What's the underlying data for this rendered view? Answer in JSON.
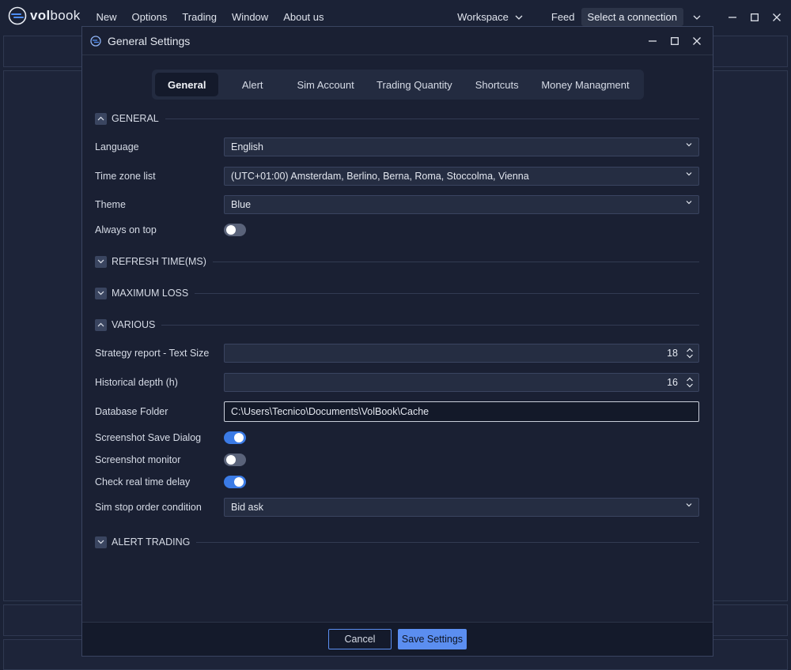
{
  "app": {
    "logo_text_bold": "vol",
    "logo_text_rest": "book",
    "menu": [
      "New",
      "Options",
      "Trading",
      "Window",
      "About us"
    ],
    "workspace_label": "Workspace",
    "feed_label": "Feed",
    "connection_label": "Select a connection"
  },
  "dialog": {
    "title": "General Settings",
    "tabs": [
      {
        "label": "General",
        "active": true
      },
      {
        "label": "Alert",
        "active": false
      },
      {
        "label": "Sim Account",
        "active": false
      },
      {
        "label": "Trading Quantity",
        "active": false
      },
      {
        "label": "Shortcuts",
        "active": false
      },
      {
        "label": "Money Managment",
        "active": false
      }
    ],
    "sections": {
      "general": "GENERAL",
      "refresh": "REFRESH TIME(MS)",
      "max_loss": "MAXIMUM LOSS",
      "various": "VARIOUS",
      "alert_trading": "ALERT TRADING"
    },
    "general": {
      "language_label": "Language",
      "language_value": "English",
      "timezone_label": "Time zone list",
      "timezone_value": "(UTC+01:00) Amsterdam, Berlino, Berna, Roma, Stoccolma, Vienna",
      "theme_label": "Theme",
      "theme_value": "Blue",
      "always_on_top_label": "Always on top",
      "always_on_top": false
    },
    "various": {
      "strategy_text_size_label": "Strategy report - Text Size",
      "strategy_text_size_value": "18",
      "historical_depth_label": "Historical depth (h)",
      "historical_depth_value": "16",
      "database_folder_label": "Database Folder",
      "database_folder_value": "C:\\Users\\Tecnico\\Documents\\VolBook\\Cache",
      "screenshot_save_dialog_label": "Screenshot Save Dialog",
      "screenshot_save_dialog": true,
      "screenshot_monitor_label": "Screenshot monitor",
      "screenshot_monitor": false,
      "check_real_time_delay_label": "Check real time delay",
      "check_real_time_delay": true,
      "sim_stop_label": "Sim stop order condition",
      "sim_stop_value": "Bid ask"
    },
    "buttons": {
      "cancel": "Cancel",
      "save": "Save Settings"
    }
  },
  "colors": {
    "background": "#1b2236",
    "accent": "#5b8ef0",
    "toggle_on": "#3b7be6",
    "toggle_off": "#5a637a"
  }
}
